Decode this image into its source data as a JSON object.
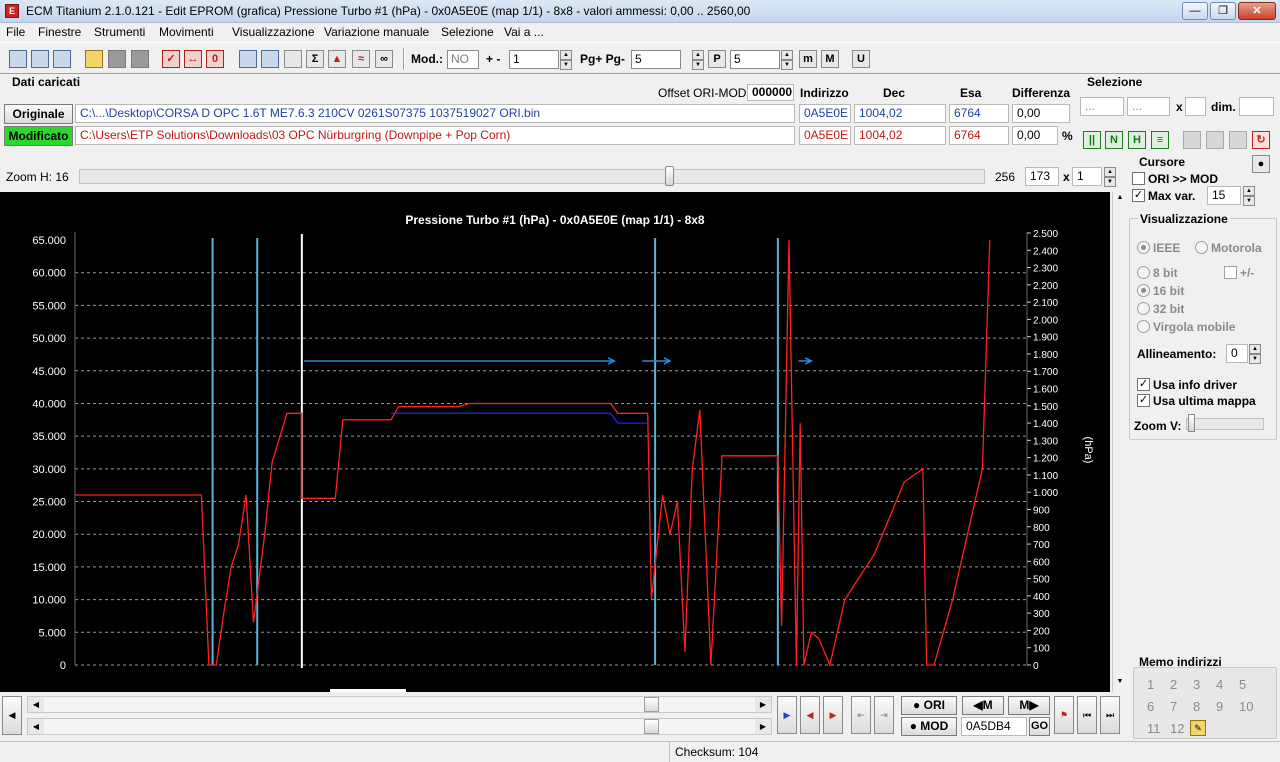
{
  "window": {
    "title": "ECM Titanium 2.1.0.121 - Edit EPROM (grafica) Pressione Turbo #1 (hPa) - 0x0A5E0E (map 1/1) - 8x8 - valori ammessi: 0,00 .. 2560,00",
    "icon": "ecm-app-icon"
  },
  "menu": [
    "File",
    "Finestre",
    "Strumenti",
    "Movimenti",
    "Visualizzazione",
    "Variazione manuale",
    "Selezione",
    "Vai a ..."
  ],
  "toolbar": {
    "mod_label": "Mod.:",
    "mod_value": "NO",
    "plusminus_label": "+ -",
    "plusminus_value": "1",
    "pg_label": "Pg+ Pg-",
    "pg_value": "5",
    "p_value": "5"
  },
  "loaded": {
    "section_title": "Dati caricati",
    "offset_label": "Offset ORI-MOD",
    "offset_value": "000000",
    "col_indirizzo": "Indirizzo",
    "col_dec": "Dec",
    "col_esa": "Esa",
    "col_diff": "Differenza",
    "original": {
      "label": "Originale",
      "path": "C:\\...\\Desktop\\CORSA D OPC 1.6T ME7.6.3 210CV 0261S07375 1037519027 ORI.bin",
      "address": "0A5E0E",
      "dec": "1004,02",
      "esa": "6764",
      "diff": "0,00"
    },
    "modified": {
      "label": "Modificato",
      "path": "C:\\Users\\ETP Solutions\\Downloads\\03 OPC Nürburgring (Downpipe + Pop Corn)",
      "address": "0A5E0E",
      "dec": "1004,02",
      "esa": "6764",
      "diff": "0,00",
      "pct": "%"
    }
  },
  "selection": {
    "title": "Selezione",
    "from": "...",
    "to": "...",
    "x": "x",
    "dim_label": "dim."
  },
  "zoom": {
    "label": "Zoom H: 16",
    "value_256": "256",
    "value_173": "173",
    "x": "x",
    "factor": "1"
  },
  "chart_data": {
    "type": "line",
    "title": "Pressione Turbo #1 (hPa) - 0x0A5E0E (map 1/1) - 8x8",
    "ylabel_right": "(hPa)",
    "left_ticks": [
      "65.000",
      "60.000",
      "55.000",
      "50.000",
      "45.000",
      "40.000",
      "35.000",
      "30.000",
      "25.000",
      "20.000",
      "15.000",
      "10.000",
      "5.000",
      "0"
    ],
    "left_ylim": [
      0,
      65000
    ],
    "right_ticks": [
      "2.500",
      "2.400",
      "2.300",
      "2.200",
      "2.100",
      "2.000",
      "1.900",
      "1.800",
      "1.700",
      "1.600",
      "1.500",
      "1.400",
      "1.300",
      "1.200",
      "1.100",
      "1.000",
      "900",
      "800",
      "700",
      "600",
      "500",
      "400",
      "300",
      "200",
      "100",
      "0"
    ],
    "right_ylim": [
      0,
      2500
    ],
    "x_range": [
      0,
      256
    ],
    "grid": "dashed horizontal",
    "cursor_lines_x": [
      37,
      49,
      156,
      189
    ],
    "selection_line_x": 61,
    "series": [
      {
        "color": "#ff2020",
        "points": [
          [
            0,
            26000
          ],
          [
            34,
            26000
          ],
          [
            36,
            0
          ],
          [
            38,
            0
          ],
          [
            40,
            8000
          ],
          [
            42,
            15000
          ],
          [
            44,
            18500
          ],
          [
            46,
            26000
          ],
          [
            48,
            6500
          ],
          [
            51,
            20000
          ],
          [
            53,
            31000
          ],
          [
            57,
            38500
          ],
          [
            61,
            38500
          ],
          [
            61,
            25500
          ],
          [
            70,
            25500
          ],
          [
            72,
            37500
          ],
          [
            85,
            37500
          ],
          [
            87,
            39500
          ],
          [
            103,
            39500
          ],
          [
            106,
            40000
          ],
          [
            144,
            40000
          ],
          [
            146,
            38500
          ],
          [
            154,
            38500
          ],
          [
            155,
            10000
          ],
          [
            158,
            26000
          ],
          [
            160,
            20000
          ],
          [
            162,
            25000
          ],
          [
            164,
            2000
          ],
          [
            166,
            30000
          ],
          [
            168,
            39000
          ],
          [
            171,
            0
          ],
          [
            174,
            32000
          ],
          [
            189,
            32000
          ],
          [
            190,
            6000
          ],
          [
            192,
            65000
          ],
          [
            194,
            0
          ],
          [
            195,
            37000
          ],
          [
            196,
            0
          ],
          [
            198,
            5000
          ],
          [
            200,
            4000
          ],
          [
            203,
            0
          ],
          [
            207,
            10000
          ],
          [
            215,
            17000
          ],
          [
            223,
            28000
          ],
          [
            228,
            30000
          ],
          [
            229,
            0
          ],
          [
            231,
            0
          ],
          [
            236,
            10000
          ],
          [
            240,
            20000
          ],
          [
            244,
            30000
          ],
          [
            246,
            65000
          ]
        ]
      },
      {
        "color": "#2020ff",
        "points": [
          [
            85,
            38500
          ],
          [
            144,
            38500
          ],
          [
            146,
            37000
          ],
          [
            154,
            37000
          ]
        ]
      }
    ],
    "arrows": [
      [
        61,
        46500,
        145
      ],
      [
        152,
        46500,
        160
      ],
      [
        194,
        46500,
        198
      ]
    ]
  },
  "cursor_panel": {
    "title": "Cursore",
    "ori_mod": "ORI >> MOD",
    "max_var_label": "Max var.",
    "max_var_value": "15"
  },
  "view_panel": {
    "title": "Visualizzazione",
    "ieee": "IEEE",
    "motorola": "Motorola",
    "bit8": "8 bit",
    "plusminus": "+/-",
    "bit16": "16 bit",
    "bit32": "32 bit",
    "float": "Virgola mobile",
    "align_label": "Allineamento:",
    "align_value": "0",
    "driver_info": "Usa info driver",
    "last_map": "Usa ultima mappa",
    "zoomv": "Zoom V:"
  },
  "memo": {
    "title": "Memo indirizzi",
    "items": [
      "1",
      "2",
      "3",
      "4",
      "5",
      "6",
      "7",
      "8",
      "9",
      "10",
      "11",
      "12"
    ]
  },
  "bottom": {
    "ori_label": "ORI",
    "mod_label": "MOD",
    "address": "0A5DB4",
    "go": "GO",
    "checksum": "Checksum: 104"
  }
}
